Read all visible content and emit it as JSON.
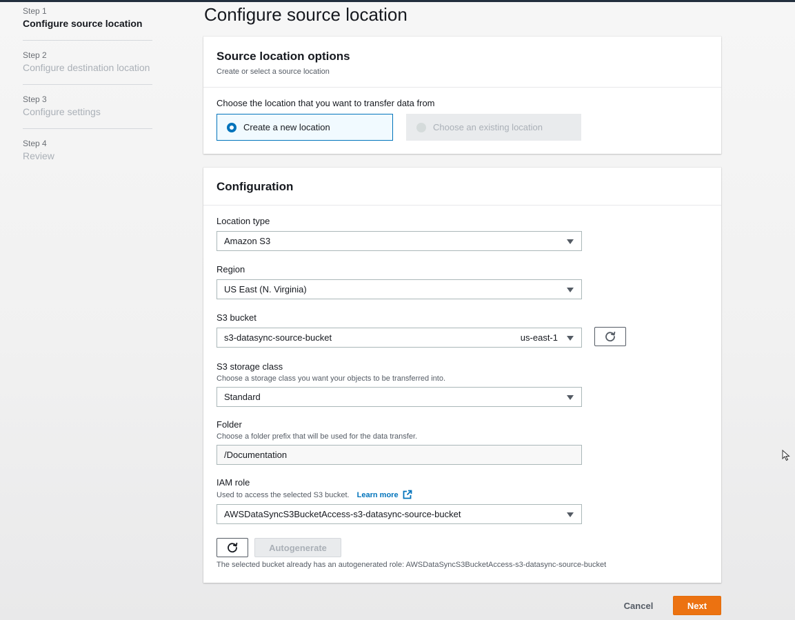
{
  "steps": [
    {
      "num": "Step 1",
      "title": "Configure source location",
      "active": true
    },
    {
      "num": "Step 2",
      "title": "Configure destination location",
      "active": false
    },
    {
      "num": "Step 3",
      "title": "Configure settings",
      "active": false
    },
    {
      "num": "Step 4",
      "title": "Review",
      "active": false
    }
  ],
  "page_title": "Configure source location",
  "source_options": {
    "title": "Source location options",
    "description": "Create or select a source location",
    "prompt": "Choose the location that you want to transfer data from",
    "create_new": "Create a new location",
    "choose_existing": "Choose an existing location"
  },
  "configuration": {
    "title": "Configuration",
    "location_type": {
      "label": "Location type",
      "value": "Amazon S3"
    },
    "region": {
      "label": "Region",
      "value": "US East (N. Virginia)"
    },
    "s3_bucket": {
      "label": "S3 bucket",
      "value": "s3-datasync-source-bucket",
      "region_tag": "us-east-1"
    },
    "storage_class": {
      "label": "S3 storage class",
      "description": "Choose a storage class you want your objects to be transferred into.",
      "value": "Standard"
    },
    "folder": {
      "label": "Folder",
      "description": "Choose a folder prefix that will be used for the data transfer.",
      "value": "/Documentation"
    },
    "iam_role": {
      "label": "IAM role",
      "description": "Used to access the selected S3 bucket.",
      "learn_more": "Learn more",
      "value": "AWSDataSyncS3BucketAccess-s3-datasync-source-bucket",
      "autogenerate": "Autogenerate",
      "note": "The selected bucket already has an autogenerated role: AWSDataSyncS3BucketAccess-s3-datasync-source-bucket"
    }
  },
  "footer": {
    "cancel": "Cancel",
    "next": "Next"
  },
  "colors": {
    "accent": "#0073bb",
    "primary_button": "#ec7211"
  }
}
